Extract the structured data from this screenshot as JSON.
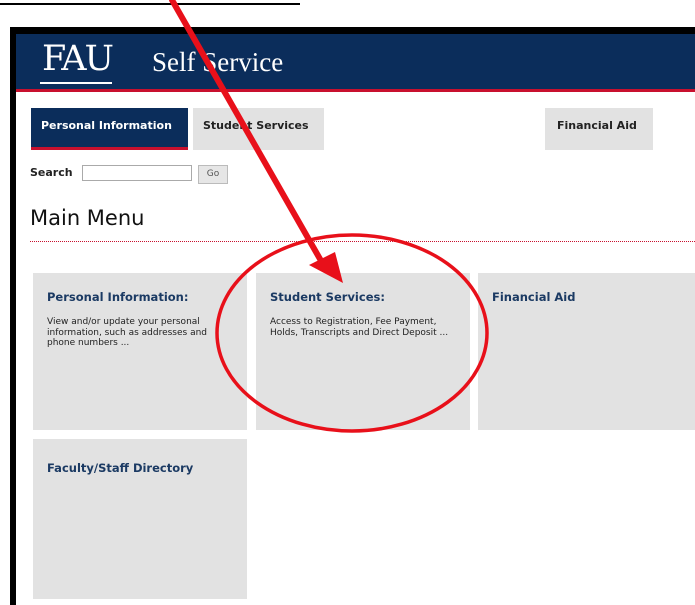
{
  "header": {
    "logo_text": "FAU",
    "app_title": "Self Service"
  },
  "tabs": [
    {
      "label": "Personal Information",
      "active": true
    },
    {
      "label": "Student Services",
      "active": false
    },
    {
      "label": "Financial Aid",
      "active": false
    }
  ],
  "search": {
    "label": "Search",
    "value": "",
    "placeholder": "",
    "button_label": "Go"
  },
  "main": {
    "title": "Main Menu"
  },
  "cards": [
    {
      "title": "Personal Information:",
      "description": "View and/or update your personal information, such as addresses and phone numbers ..."
    },
    {
      "title": "Student Services:",
      "description": "Access to Registration, Fee Payment, Holds, Transcripts and Direct Deposit ..."
    },
    {
      "title": "Financial Aid",
      "description": ""
    },
    {
      "title": "Faculty/Staff Directory",
      "description": ""
    }
  ],
  "annotations": {
    "arrow_color": "#e8101a",
    "circle_color": "#e8101a"
  },
  "colors": {
    "header_bg": "#0b2d5b",
    "accent_red": "#c8102e",
    "card_bg": "#e2e2e2"
  }
}
